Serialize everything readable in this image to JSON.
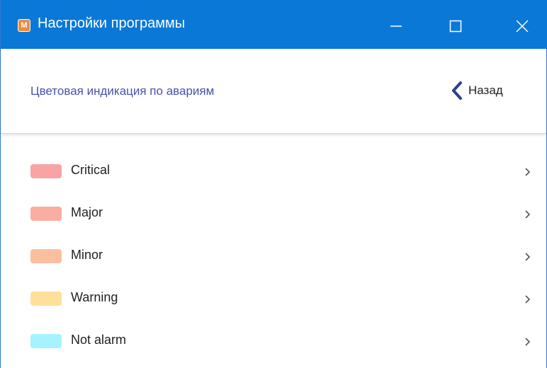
{
  "window": {
    "title": "Настройки программы",
    "app_icon": "app-logo-icon",
    "controls": [
      "minimize-icon",
      "maximize-icon",
      "close-icon"
    ],
    "accent_color": "#0a78d7"
  },
  "header": {
    "section_title": "Цветовая индикация по авариям",
    "back_label": "Назад",
    "back_icon": "chevron-left-icon",
    "title_color": "#4a4fb0"
  },
  "alarms": [
    {
      "label": "Critical",
      "color": "#f9a3a5"
    },
    {
      "label": "Major",
      "color": "#f9aea0"
    },
    {
      "label": "Minor",
      "color": "#fbbfa0"
    },
    {
      "label": "Warning",
      "color": "#ffe09a"
    },
    {
      "label": "Not alarm",
      "color": "#a5f3ff"
    }
  ]
}
